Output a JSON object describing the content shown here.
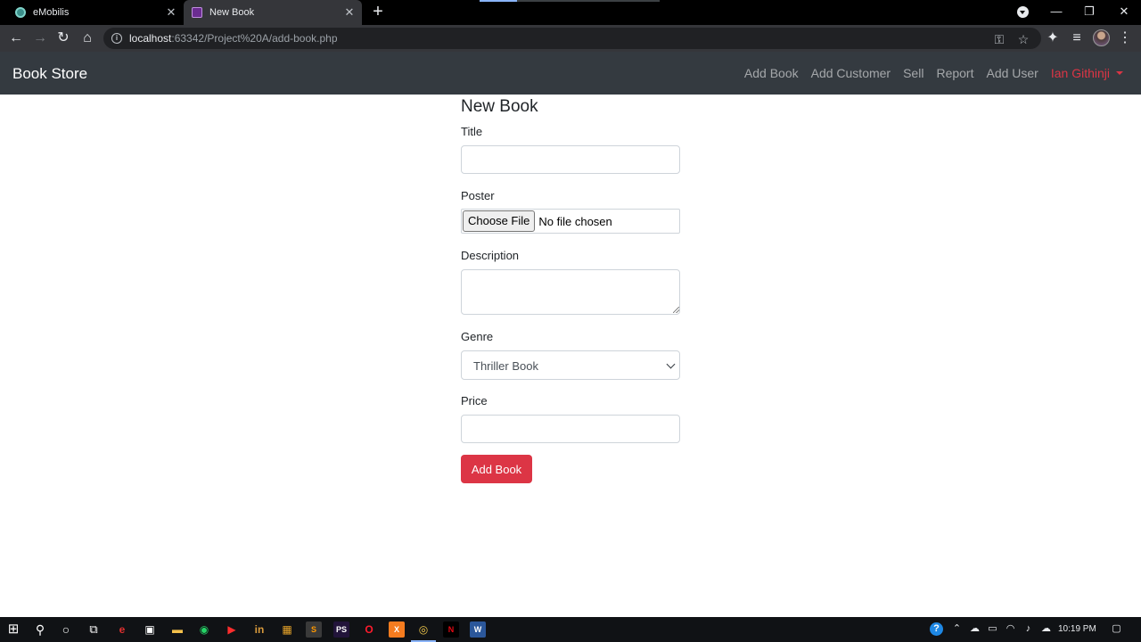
{
  "browser": {
    "tabs": [
      {
        "title": "eMobilis",
        "active": false
      },
      {
        "title": "New Book",
        "active": true
      }
    ],
    "url_host": "localhost",
    "url_path": ":63342/Project%20A/add-book.php",
    "icons": {
      "close": "✕",
      "new_tab": "+",
      "minimize": "—",
      "maximize": "❐",
      "window_close": "✕",
      "back": "←",
      "forward": "→",
      "reload": "↻",
      "home": "⌂",
      "info": "i",
      "key": "⚿",
      "star": "☆",
      "extensions": "✦",
      "media": "≡",
      "menu": "⋮"
    }
  },
  "navbar": {
    "brand": "Book Store",
    "links": [
      "Add Book",
      "Add Customer",
      "Sell",
      "Report",
      "Add User"
    ],
    "user": "Ian Githinji",
    "colors": {
      "background": "#343a40",
      "user": "#dc3545"
    }
  },
  "form": {
    "heading": "New Book",
    "title_label": "Title",
    "title_value": "",
    "poster_label": "Poster",
    "poster_button": "Choose File",
    "poster_status": "No file chosen",
    "description_label": "Description",
    "description_value": "",
    "genre_label": "Genre",
    "genre_selected": "Thriller Book",
    "price_label": "Price",
    "price_value": "",
    "submit": "Add Book",
    "colors": {
      "submit": "#dc3545"
    }
  },
  "taskbar": {
    "apps": [
      "windows-start",
      "search",
      "cortana",
      "task-view",
      "edge",
      "store",
      "file-explorer",
      "whatsapp",
      "youtube",
      "linkedin",
      "office",
      "sublime-text",
      "phpstorm",
      "opera",
      "xampp",
      "chrome",
      "netflix",
      "word"
    ],
    "time": "10:19 PM"
  }
}
